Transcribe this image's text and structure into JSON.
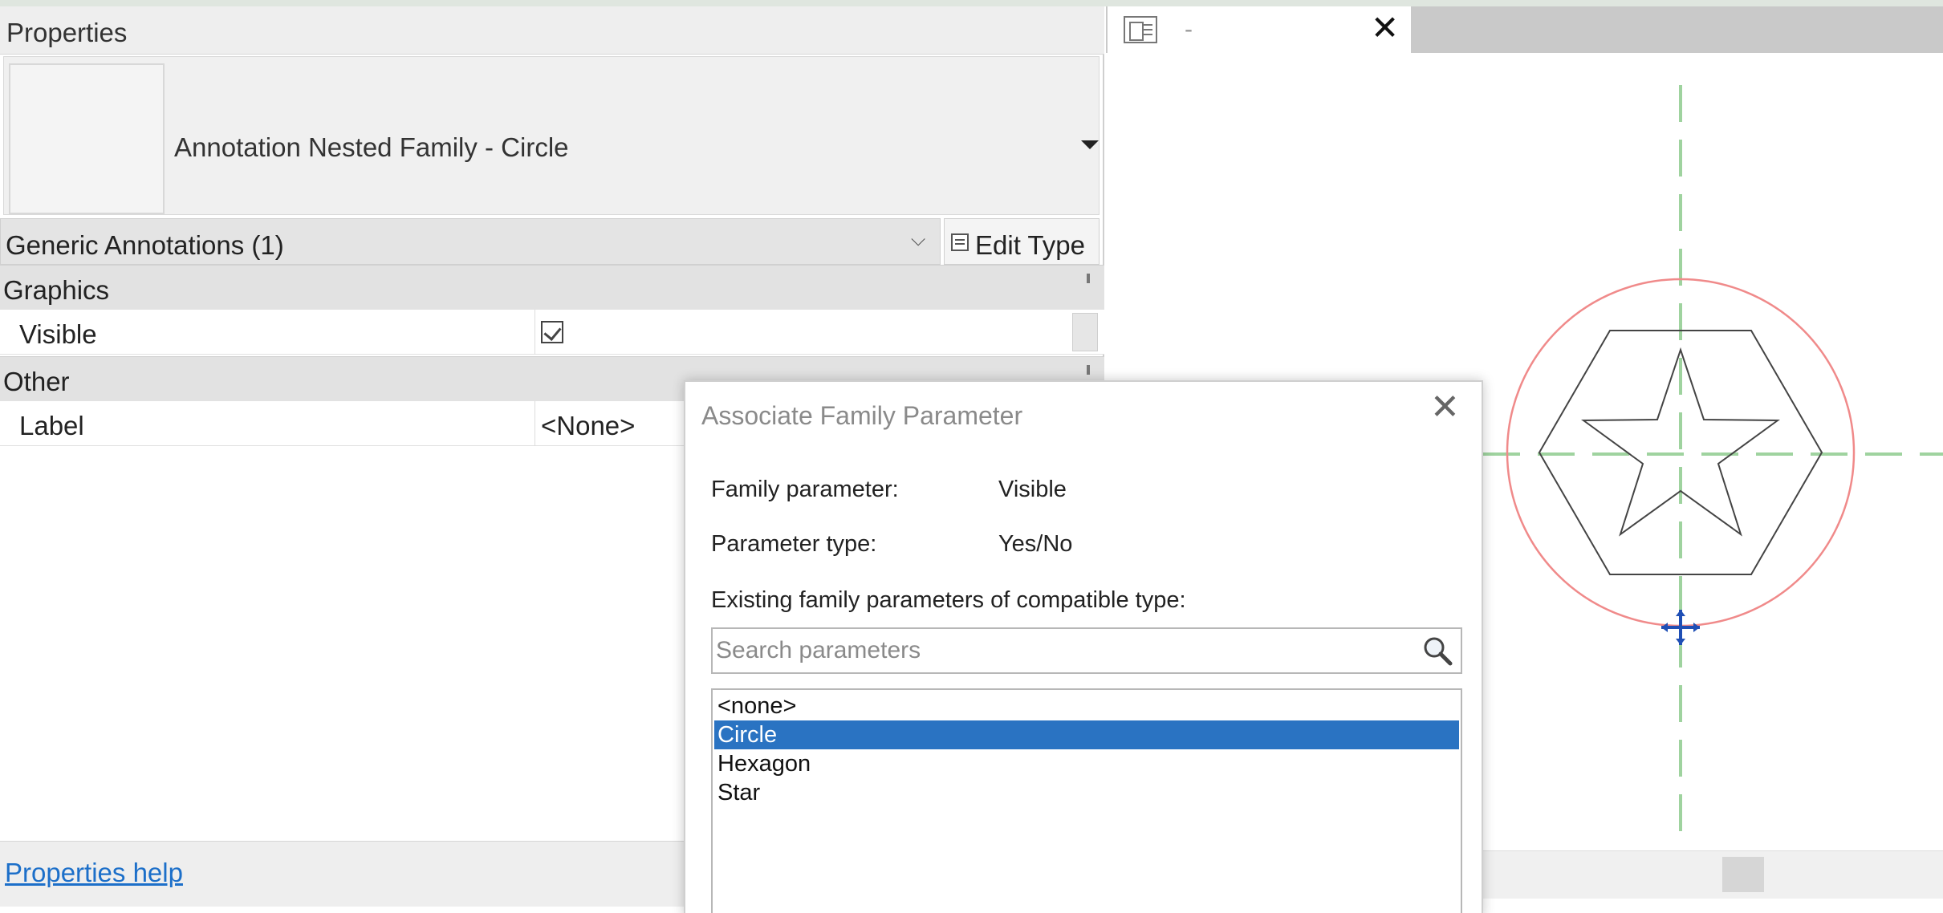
{
  "properties": {
    "title": "Properties",
    "type_name": "Annotation Nested Family - Circle",
    "instance_filter": "Generic Annotations (1)",
    "edit_type": "Edit Type",
    "groups": [
      {
        "label": "Graphics",
        "rows": [
          {
            "name": "Visible",
            "checked": true
          }
        ]
      },
      {
        "label": "Other",
        "rows": [
          {
            "name": "Label",
            "value": "<None>"
          }
        ]
      }
    ],
    "help_link": "Properties help"
  },
  "view": {
    "tab_title": "-",
    "close_glyph": "✕"
  },
  "dialog": {
    "title": "Associate Family Parameter",
    "close_glyph": "✕",
    "family_parameter_label": "Family parameter:",
    "family_parameter_value": "Visible",
    "parameter_type_label": "Parameter type:",
    "parameter_type_value": "Yes/No",
    "existing_label": "Existing family parameters of compatible type:",
    "search_placeholder": "Search parameters",
    "items": [
      "<none>",
      "Circle",
      "Hexagon",
      "Star"
    ],
    "selected": "Circle"
  },
  "icons": {
    "dropdown": "caret-down-icon",
    "chevron": "chevron-down-icon",
    "edit_type": "edit-type-icon",
    "checkbox": "checkbox-checked-icon",
    "view_tab": "sheet-view-icon",
    "search": "magnifier-icon",
    "move": "move-grip-icon"
  },
  "colors": {
    "selection": "#2a73c2",
    "link": "#1c6fc9",
    "circle_stroke": "#f08a8a",
    "ref_plane": "#9fd39f",
    "grip": "#1f4fb5"
  }
}
